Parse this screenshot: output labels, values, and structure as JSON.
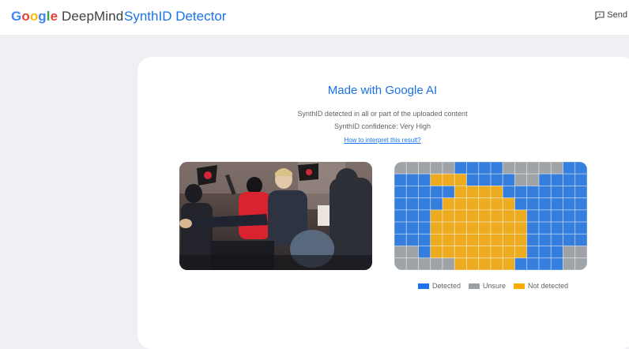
{
  "header": {
    "brand_google": "Google",
    "brand_suffix": "DeepMind",
    "product": "SynthID Detector",
    "feedback_label": "Send"
  },
  "result": {
    "headline": "Made with Google AI",
    "line1": "SynthID detected in all or part of the uploaded content",
    "line2": "SynthID confidence: Very High",
    "link": "How to interpret this result?"
  },
  "legend": [
    {
      "label": "Detected",
      "color": "#1a73e8"
    },
    {
      "label": "Unsure",
      "color": "#9aa0a6"
    },
    {
      "label": "Not detected",
      "color": "#f9ab00"
    }
  ],
  "colors": {
    "accent": "#1a73e8",
    "google_blue": "#4285f4",
    "google_red": "#ea4335",
    "google_yellow": "#fbbc05",
    "google_green": "#34a853"
  }
}
